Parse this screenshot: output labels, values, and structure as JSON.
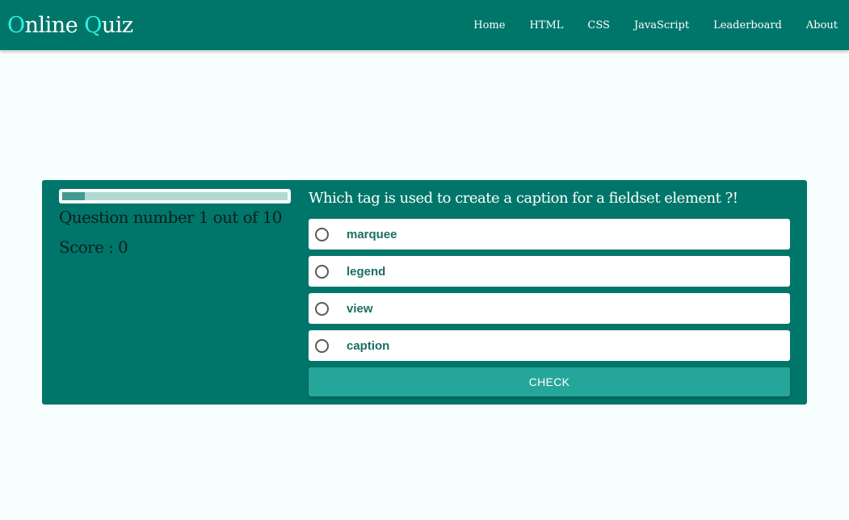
{
  "header": {
    "brand_first_letter": "O",
    "brand_first_rest": "nline ",
    "brand_second_letter": "Q",
    "brand_second_rest": "uiz",
    "nav": [
      "Home",
      "HTML",
      "CSS",
      "JavaScript",
      "Leaderboard",
      "About"
    ]
  },
  "quiz": {
    "progress": {
      "current": 1,
      "total": 10,
      "fraction": 0.1
    },
    "question_number_text": "Question number 1 out of 10",
    "score_text": "Score : 0",
    "question": "Which tag is used to create a caption for a fieldset element ?!",
    "answers": [
      "marquee",
      "legend",
      "view",
      "caption"
    ],
    "check_label": "CHECK"
  },
  "colors": {
    "primary": "#00766a",
    "accent": "#2ff0e0",
    "button": "#26a69a",
    "background": "#f7fffe"
  }
}
